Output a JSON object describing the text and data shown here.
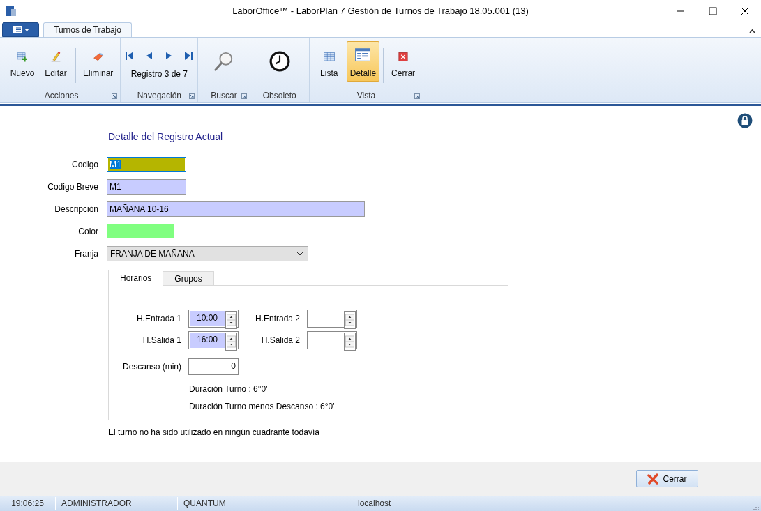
{
  "window": {
    "title": "LaborOffice™ - LaborPlan 7 Gestión de Turnos de Trabajo 18.05.001 (13)"
  },
  "ribbon_tabs": [
    {
      "label": "Turnos de Trabajo",
      "selected": true
    }
  ],
  "ribbon": {
    "groups": [
      {
        "kind": "buttons",
        "label": "Acciones",
        "launcher": true,
        "buttons": [
          {
            "label": "Nuevo",
            "selected": false,
            "separated": false
          },
          {
            "label": "Editar",
            "selected": false,
            "separated": false
          },
          {
            "label": "Eliminar",
            "selected": false,
            "separated": true
          }
        ]
      },
      {
        "kind": "nav",
        "label": "Navegación",
        "launcher": true,
        "reading": "Registro 3 de 7"
      },
      {
        "kind": "buttons",
        "label": "Buscar",
        "launcher": true,
        "buttons": [
          {
            "selected": false,
            "separated": false
          }
        ]
      },
      {
        "kind": "buttons",
        "label": "Obsoleto",
        "launcher": false,
        "buttons": [
          {
            "selected": false,
            "separated": false
          }
        ]
      },
      {
        "kind": "buttons",
        "label": "Vista",
        "launcher": true,
        "buttons": [
          {
            "label": "Lista",
            "selected": false,
            "separated": false
          },
          {
            "label": "Detalle",
            "selected": true,
            "separated": false
          },
          {
            "label": "Cerrar",
            "selected": false,
            "separated": true
          }
        ]
      }
    ]
  },
  "form": {
    "title": "Detalle del Registro Actual",
    "fields": [
      {
        "kind": "text",
        "label": "Codigo",
        "value": "M1",
        "focused": true
      },
      {
        "kind": "text",
        "label": "Codigo Breve",
        "value": "M1",
        "focused": false
      },
      {
        "kind": "text",
        "label": "Descripción",
        "value": "MAÑANA 10-16",
        "focused": false
      },
      {
        "kind": "color",
        "label": "Color",
        "color": "#80ff80"
      },
      {
        "kind": "select",
        "label": "Franja",
        "value": "FRANJA DE MAÑANA"
      }
    ]
  },
  "tabs": [
    {
      "label": "Horarios",
      "selected": true
    },
    {
      "label": "Grupos",
      "selected": false
    }
  ],
  "horarios": {
    "times": [
      {
        "label": "H.Entrada 1",
        "value": "10:00"
      },
      {
        "label": "H.Entrada 2"
      },
      {
        "label": "H.Salida 1",
        "value": "16:00"
      },
      {
        "label": "H.Salida 2"
      }
    ],
    "descanso": {
      "label": "Descanso (min)",
      "value": "0"
    },
    "durations": [
      "Duración Turno : 6°0'",
      "Duración Turno menos Descanso : 6°0'"
    ]
  },
  "note": "El turno no ha sido utilizado en ningún cuadrante todavía",
  "footer_button": "Cerrar",
  "status_bar": [
    "19:06:25",
    "ADMINISTRADOR",
    "QUANTUM",
    "localhost"
  ]
}
